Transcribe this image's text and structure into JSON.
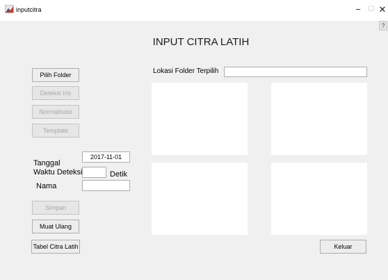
{
  "window": {
    "title": "inputcitra",
    "minimize_glyph": "−",
    "maximize_glyph": "☐",
    "close_glyph": "✕",
    "help_glyph": "?"
  },
  "heading": "INPUT CITRA LATIH",
  "buttons": {
    "pilih_folder": "Pilih Folder",
    "deteksi_iris": "Deteksi Iris",
    "normalisasi": "Normalisasi",
    "template": "Template",
    "simpan": "Simpan",
    "muat_ulang": "Muat Ulang",
    "tabel_citra_latih": "Tabel Citra Latih",
    "keluar": "Keluar"
  },
  "form": {
    "tanggal_label": "Tanggal",
    "tanggal_value": "2017-11-01",
    "waktu_deteksi_label": "Waktu Deteksi",
    "waktu_deteksi_value": "",
    "waktu_deteksi_unit": "Detik",
    "nama_label": "Nama",
    "nama_value": ""
  },
  "folder": {
    "label": "Lokasi Folder Terpilih",
    "value": ""
  },
  "colors": {
    "window_bg": "#f0f0f0",
    "panel_bg": "#ffffff",
    "disabled_text": "#a8a8a8"
  }
}
